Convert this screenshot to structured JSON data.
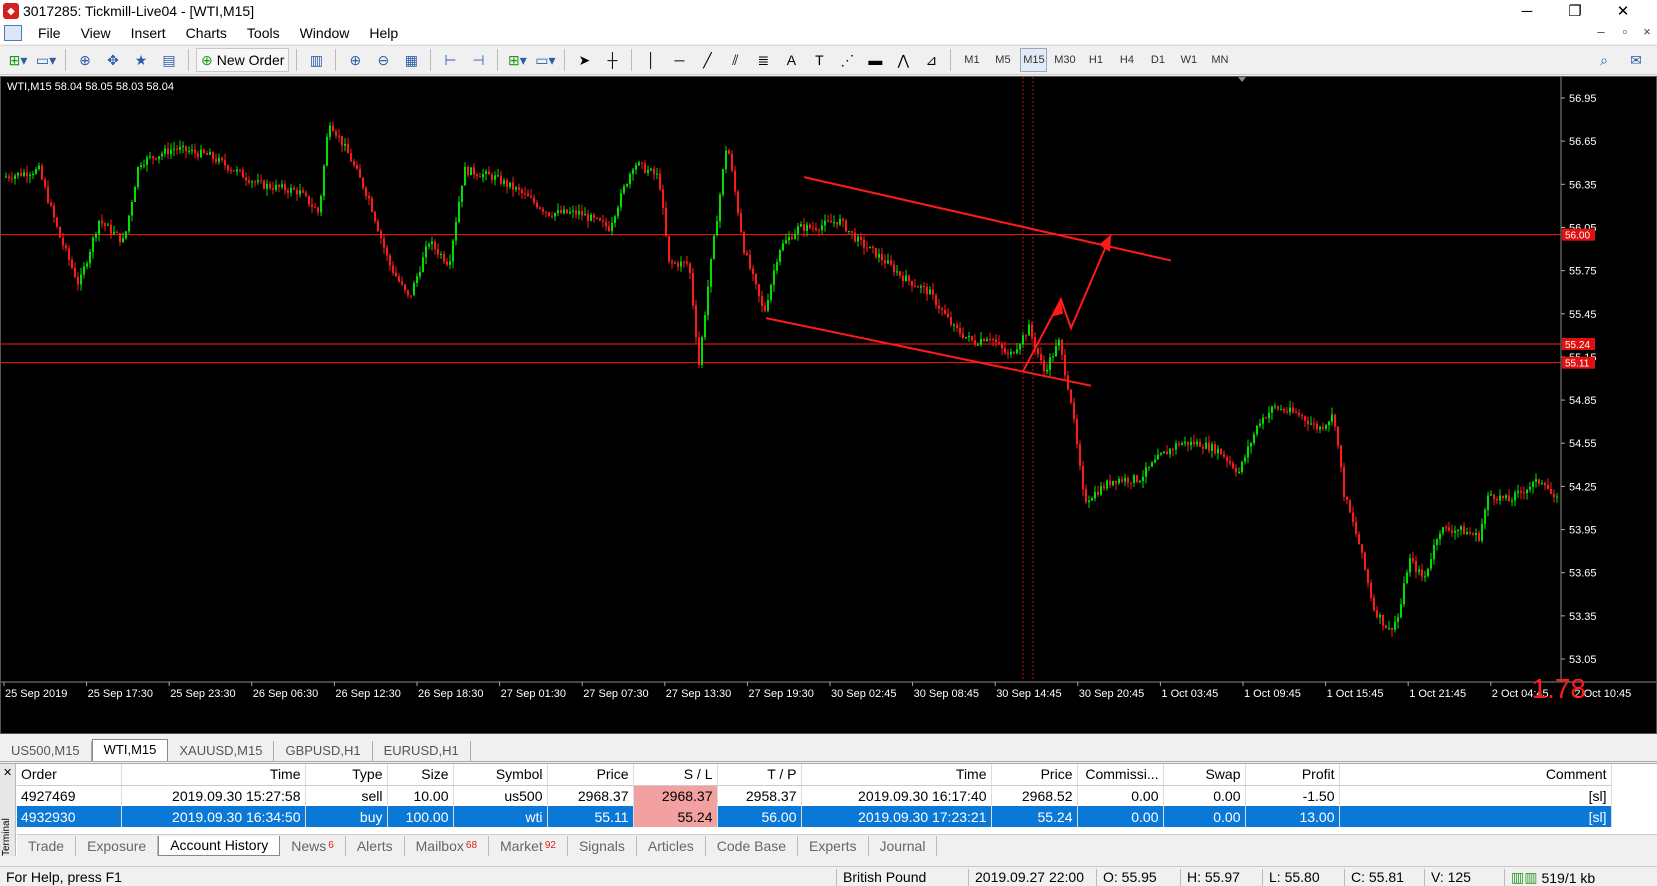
{
  "window": {
    "title": "3017285: Tickmill-Live04 - [WTI,M15]",
    "controls": [
      "─",
      "❐",
      "✕"
    ]
  },
  "menu": [
    "File",
    "View",
    "Insert",
    "Charts",
    "Tools",
    "Window",
    "Help"
  ],
  "toolbar": {
    "new_order_label": "New Order",
    "timeframes": [
      "M1",
      "M5",
      "M15",
      "M30",
      "H1",
      "H4",
      "D1",
      "W1",
      "MN"
    ],
    "active_timeframe": "M15"
  },
  "chart": {
    "symbol_info": "WTI,M15  58.04 58.05 58.03 58.04",
    "corner_value": "1.78",
    "price_axis": [
      "56.95",
      "56.65",
      "56.35",
      "56.05",
      "55.75",
      "55.45",
      "55.15",
      "54.85",
      "54.55",
      "54.25",
      "53.95",
      "53.65",
      "53.35",
      "53.05"
    ],
    "hline_labels": [
      "56.00",
      "55.24",
      "55.11"
    ],
    "time_axis": [
      "25 Sep 2019",
      "25 Sep 17:30",
      "25 Sep 23:30",
      "26 Sep 06:30",
      "26 Sep 12:30",
      "26 Sep 18:30",
      "27 Sep 01:30",
      "27 Sep 07:30",
      "27 Sep 13:30",
      "27 Sep 19:30",
      "30 Sep 02:45",
      "30 Sep 08:45",
      "30 Sep 14:45",
      "30 Sep 20:45",
      "1 Oct 03:45",
      "1 Oct 09:45",
      "1 Oct 15:45",
      "1 Oct 21:45",
      "2 Oct 04:45",
      "2 Oct 10:45"
    ],
    "colors": {
      "bull": "#00e000",
      "bear": "#ff1a1a",
      "line": "#ff1a1a"
    }
  },
  "chart_tabs": [
    "US500,M15",
    "WTI,M15",
    "XAUUSD,M15",
    "GBPUSD,H1",
    "EURUSD,H1"
  ],
  "active_chart_tab": "WTI,M15",
  "terminal": {
    "side_label": "Terminal",
    "columns": [
      "Order",
      "Time",
      "Type",
      "Size",
      "Symbol",
      "Price",
      "S / L",
      "T / P",
      "Time",
      "Price",
      "Commissi...",
      "Swap",
      "Profit",
      "Comment"
    ],
    "rows": [
      [
        "4927469",
        "2019.09.30 15:27:58",
        "sell",
        "10.00",
        "us500",
        "2968.37",
        "2968.37",
        "2958.37",
        "2019.09.30 16:17:40",
        "2968.52",
        "0.00",
        "0.00",
        "-1.50",
        "[sl]"
      ],
      [
        "4932930",
        "2019.09.30 16:34:50",
        "buy",
        "100.00",
        "wti",
        "55.11",
        "55.24",
        "56.00",
        "2019.09.30 17:23:21",
        "55.24",
        "0.00",
        "0.00",
        "13.00",
        "[sl]"
      ]
    ],
    "tabs": [
      {
        "label": "Trade",
        "badge": ""
      },
      {
        "label": "Exposure",
        "badge": ""
      },
      {
        "label": "Account History",
        "badge": ""
      },
      {
        "label": "News",
        "badge": "6"
      },
      {
        "label": "Alerts",
        "badge": ""
      },
      {
        "label": "Mailbox",
        "badge": "68"
      },
      {
        "label": "Market",
        "badge": "92"
      },
      {
        "label": "Signals",
        "badge": ""
      },
      {
        "label": "Articles",
        "badge": ""
      },
      {
        "label": "Code Base",
        "badge": ""
      },
      {
        "label": "Experts",
        "badge": ""
      },
      {
        "label": "Journal",
        "badge": ""
      }
    ],
    "active_tab": "Account History"
  },
  "status": {
    "help": "For Help, press F1",
    "profile": "British Pound",
    "datetime": "2019.09.27 22:00",
    "open": "O: 55.95",
    "high": "H: 55.97",
    "low": "L: 55.80",
    "close": "C: 55.81",
    "volume": "V: 125",
    "traffic": "519/1 kb"
  }
}
